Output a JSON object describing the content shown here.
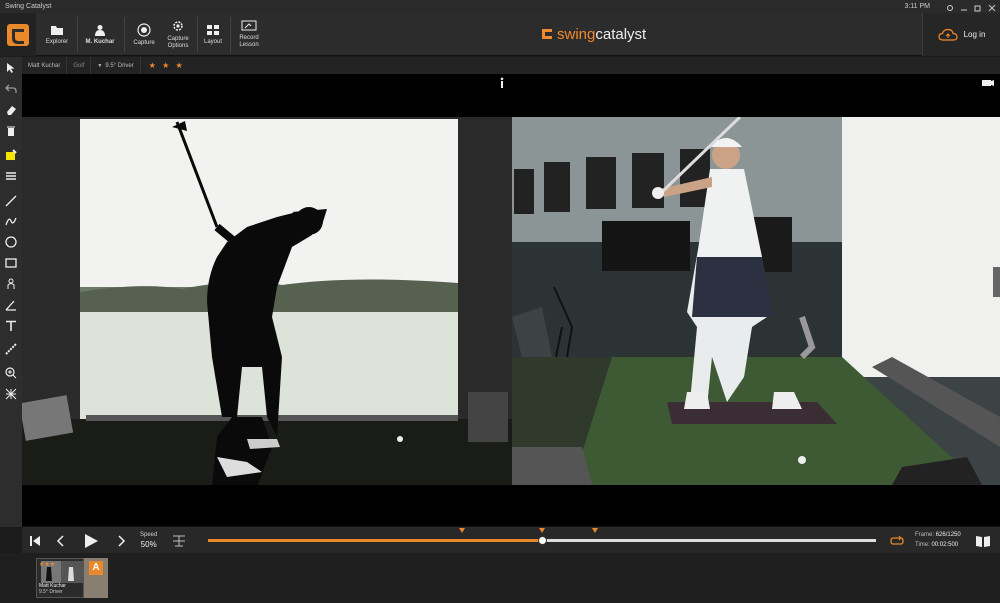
{
  "window": {
    "title": "Swing Catalyst",
    "clock": "3:11 PM"
  },
  "toolbar": {
    "explorer_label": "Explorer",
    "player_label": "M. Kuchar",
    "capture_label": "Capture",
    "capture_options_label_1": "Capture",
    "capture_options_label_2": "Options",
    "layout_label": "Layout",
    "record_label_1": "Record",
    "record_label_2": "Lesson",
    "login_label": "Log in"
  },
  "brand": {
    "part1": "swing",
    "part2": "catalyst",
    "accent": "#f08a2c"
  },
  "infobar": {
    "player": "Matt Kuchar",
    "sport": "Golf",
    "club": "9.5° Driver",
    "rating": "★ ★ ★"
  },
  "sidebar_tools": [
    "pointer-icon",
    "undo-icon",
    "eraser-icon",
    "trash-icon",
    "highlighter-icon",
    "lines-icon",
    "line-tool-icon",
    "freehand-icon",
    "circle-tool-icon",
    "rectangle-tool-icon",
    "body-tool-icon",
    "angle-tool-icon",
    "text-tool-icon",
    "measure-tool-icon",
    "zoom-icon",
    "grid-icon"
  ],
  "playback": {
    "speed_label": "Speed",
    "speed_value": "50%",
    "progress": 0.5,
    "markers": [
      0.38,
      0.5,
      0.58
    ],
    "frame_label": "Frame:",
    "frame_value": "626/1250",
    "time_label": "Time:",
    "time_value": "00:02:500"
  },
  "thumbnail": {
    "rating": "★★★",
    "name": "Matt Kuchar",
    "club": "9.5° Driver",
    "badge": "A"
  }
}
